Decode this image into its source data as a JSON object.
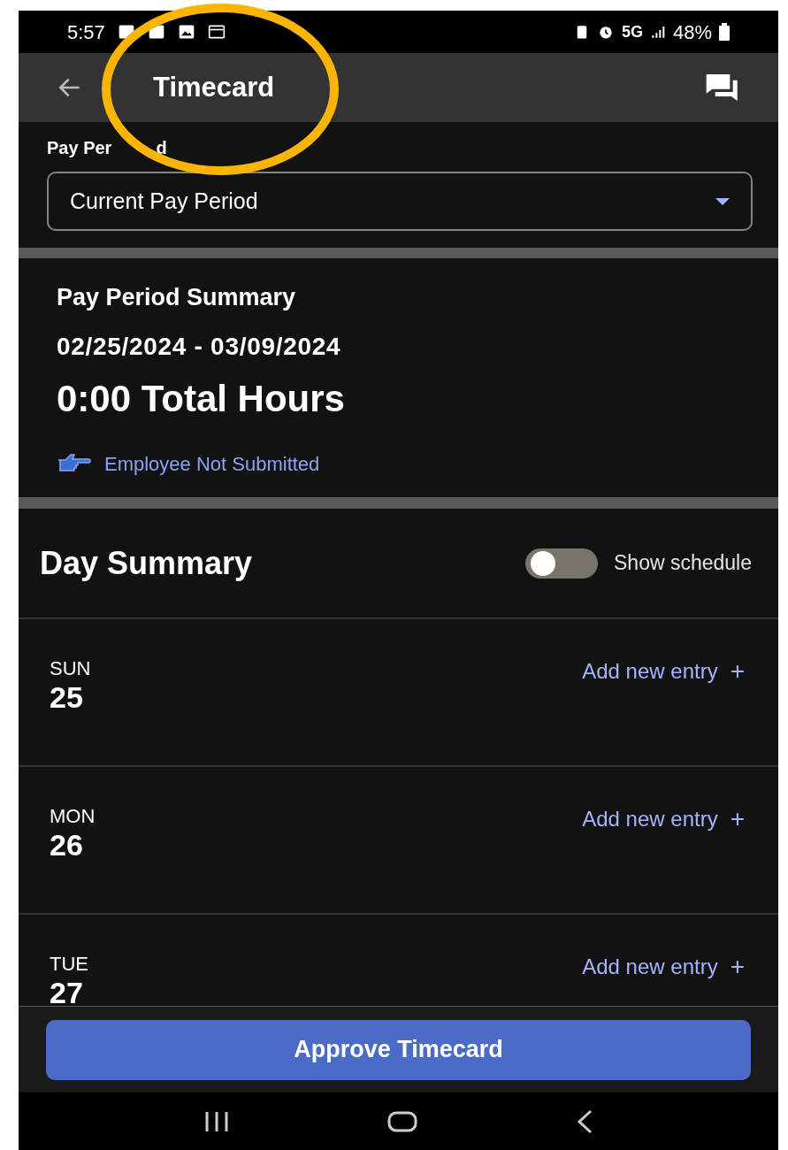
{
  "status_bar": {
    "time": "5:57",
    "network": "5G",
    "battery": "48%"
  },
  "header": {
    "title": "Timecard"
  },
  "pay_period": {
    "label_parts": [
      "Pay Per",
      "d"
    ],
    "value": "Current Pay Period"
  },
  "summary": {
    "title": "Pay Period Summary",
    "dates": "02/25/2024 - 03/09/2024",
    "total": "0:00 Total Hours",
    "status": "Employee Not Submitted"
  },
  "day_summary": {
    "title": "Day Summary",
    "toggle": {
      "label": "Show schedule",
      "on": false
    }
  },
  "days": [
    {
      "weekday": "SUN",
      "date": "25",
      "action": "Add new entry",
      "action_icon": "+"
    },
    {
      "weekday": "MON",
      "date": "26",
      "action": "Add new entry",
      "action_icon": "+"
    },
    {
      "weekday": "TUE",
      "date": "27",
      "action": "Add new entry",
      "action_icon": "+"
    }
  ],
  "primary_button": "Approve Timecard",
  "annotation": {
    "kind": "circle",
    "color": "#fbb500"
  }
}
